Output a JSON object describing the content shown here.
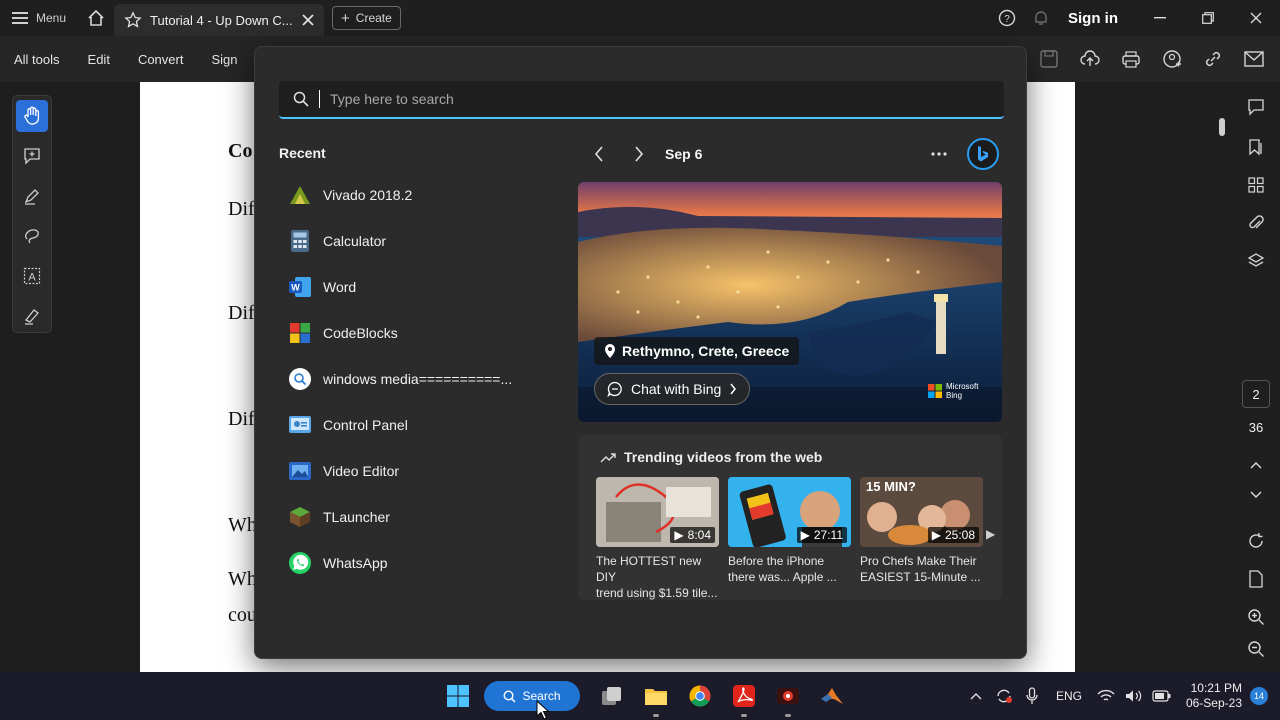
{
  "acrobat": {
    "menu_label": "Menu",
    "tab_title": "Tutorial 4 - Up Down C...",
    "create_label": "Create",
    "sign_in": "Sign in",
    "toolbar_menus": [
      "All tools",
      "Edit",
      "Convert",
      "Sign"
    ],
    "page_current": "2",
    "page_total": "36"
  },
  "document": {
    "fragments": [
      "Co",
      "Dif",
      "Dif",
      "Dif",
      "Wh",
      "Wh",
      "cou"
    ]
  },
  "search": {
    "placeholder": "Type here to search"
  },
  "recent": {
    "title": "Recent",
    "items": [
      {
        "label": "Vivado 2018.2",
        "icon": "vivado-icon"
      },
      {
        "label": "Calculator",
        "icon": "calculator-icon"
      },
      {
        "label": "Word",
        "icon": "word-icon"
      },
      {
        "label": "CodeBlocks",
        "icon": "codeblocks-icon"
      },
      {
        "label": "windows media==========...",
        "icon": "search-result-icon"
      },
      {
        "label": "Control Panel",
        "icon": "control-panel-icon"
      },
      {
        "label": "Video Editor",
        "icon": "video-editor-icon"
      },
      {
        "label": "TLauncher",
        "icon": "tlauncher-icon"
      },
      {
        "label": "WhatsApp",
        "icon": "whatsapp-icon"
      }
    ]
  },
  "highlights": {
    "date": "Sep 6",
    "location": "Rethymno, Crete, Greece",
    "chat_label": "Chat with Bing",
    "brand_line1": "Microsoft",
    "brand_line2": "Bing"
  },
  "trending": {
    "title": "Trending videos from the web",
    "videos": [
      {
        "duration": "8:04",
        "title_line1": "The HOTTEST new DIY",
        "title_line2": "trend using $1.59 tile..."
      },
      {
        "duration": "27:11",
        "title_line1": "Before the iPhone",
        "title_line2": "there was... Apple ..."
      },
      {
        "duration": "25:08",
        "title_line1": "Pro Chefs Make Their",
        "title_line2": "EASIEST 15-Minute ...",
        "thumb_text": "15 MIN?"
      }
    ]
  },
  "taskbar": {
    "search_label": "Search",
    "language": "ENG",
    "time": "10:21 PM",
    "date": "06-Sep-23",
    "notification_count": "14"
  },
  "colors": {
    "accent": "#4cc2ff",
    "taskbar_search": "#2074d4",
    "active_tool": "#2b6fd8"
  }
}
